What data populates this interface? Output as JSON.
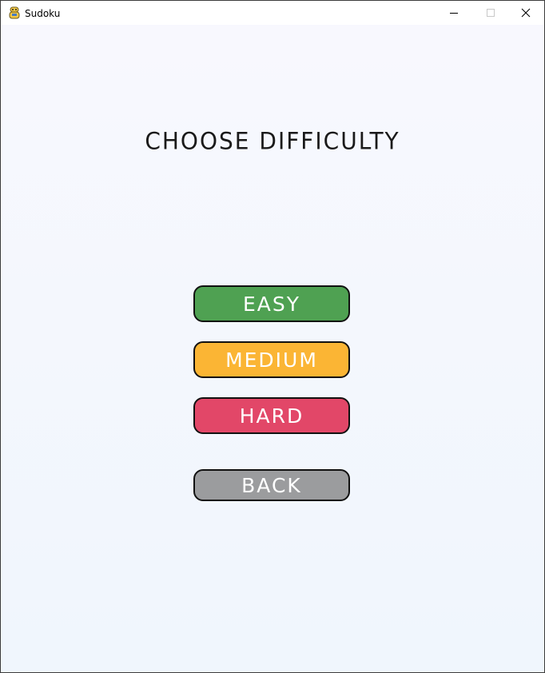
{
  "window": {
    "title": "Sudoku",
    "app_icon": "python-snake-icon",
    "controls": {
      "minimize_icon": "minimize-icon",
      "maximize_icon": "maximize-icon",
      "close_icon": "close-icon"
    }
  },
  "screen": {
    "heading": "CHOOSE DIFFICULTY"
  },
  "buttons": {
    "easy": {
      "label": "EASY",
      "color": "#4fa152"
    },
    "medium": {
      "label": "MEDIUM",
      "color": "#fbb534"
    },
    "hard": {
      "label": "HARD",
      "color": "#e24768"
    },
    "back": {
      "label": "BACK",
      "color": "#9b9c9e"
    }
  }
}
